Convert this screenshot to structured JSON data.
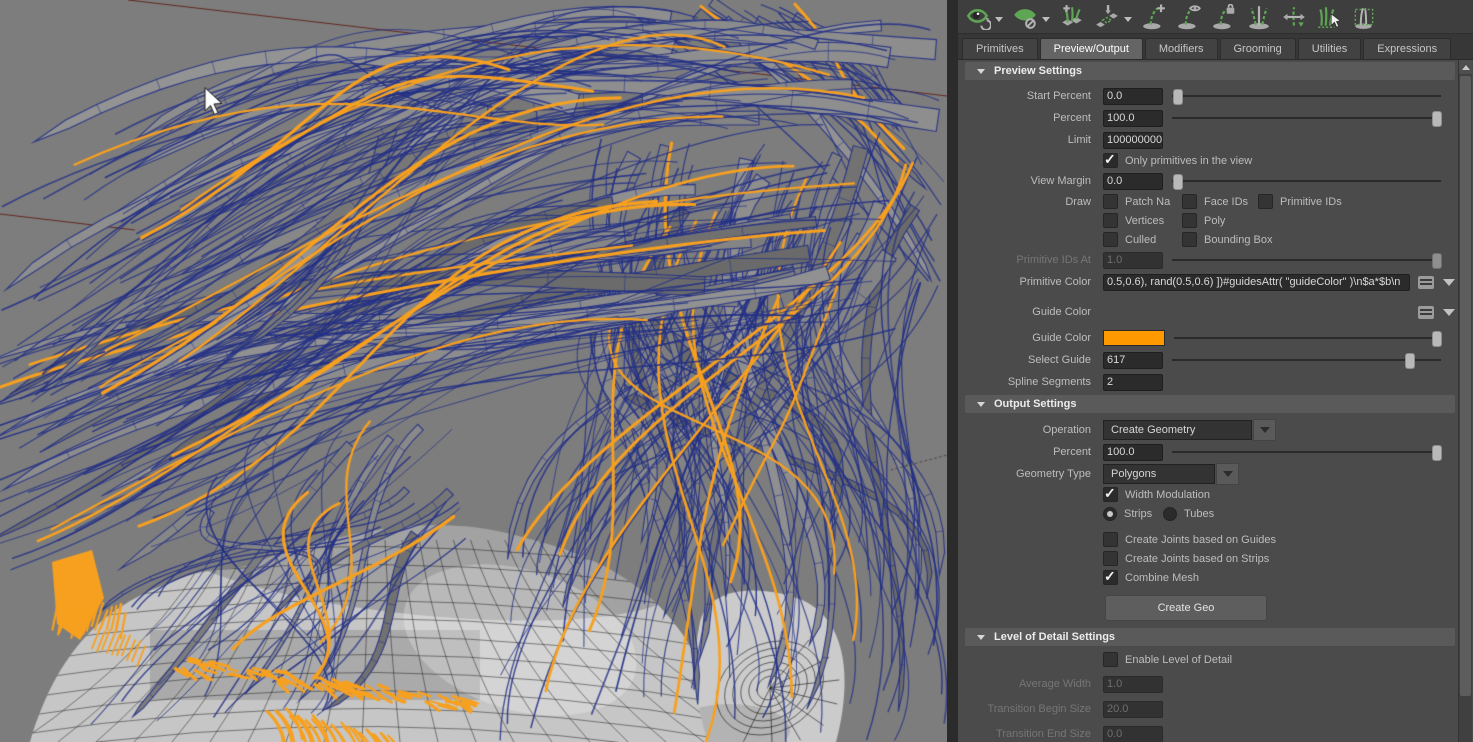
{
  "viewport": {
    "background": "#7d7d7d",
    "hair_fill_color": "#848484",
    "hair_wire_color": "#222f85",
    "guide_color": "#f7a01f",
    "head_color": "#c6c6c6",
    "head_wire_color": "#1b1b1b",
    "grid_line_color": "#63261f",
    "cursor": "arrow"
  },
  "toolbar": {
    "accent_color": "#5ea653",
    "icons": [
      {
        "name": "eye-rotate-icon",
        "dropdown": true
      },
      {
        "name": "eye-disabled-icon",
        "dropdown": true
      },
      {
        "name": "grass-add-icon",
        "dropdown": false
      },
      {
        "name": "strips-insert-icon",
        "dropdown": true
      },
      {
        "name": "strand-add-icon",
        "dropdown": false
      },
      {
        "name": "strand-visibility-icon",
        "dropdown": false
      },
      {
        "name": "strand-lock-icon",
        "dropdown": false
      },
      {
        "name": "strand-split-icon",
        "dropdown": false
      },
      {
        "name": "strand-swap-icon",
        "dropdown": false
      },
      {
        "name": "grass-select-icon",
        "dropdown": false
      },
      {
        "name": "strand-marquee-icon",
        "dropdown": false
      }
    ]
  },
  "tabs": [
    {
      "label": "Primitives",
      "selected": false
    },
    {
      "label": "Preview/Output",
      "selected": true
    },
    {
      "label": "Modifiers",
      "selected": false
    },
    {
      "label": "Grooming",
      "selected": false
    },
    {
      "label": "Utilities",
      "selected": false
    },
    {
      "label": "Expressions",
      "selected": false
    }
  ],
  "preview": {
    "title": "Preview Settings",
    "start_percent": {
      "label": "Start Percent",
      "value": "0.0",
      "slider": 0.02
    },
    "percent": {
      "label": "Percent",
      "value": "100.0",
      "slider": 0.98
    },
    "limit": {
      "label": "Limit",
      "value": "100000000"
    },
    "only_primitives": {
      "label": "Only primitives in the view",
      "checked": true
    },
    "view_margin": {
      "label": "View Margin",
      "value": "0.0",
      "slider": 0.02
    },
    "draw": {
      "label": "Draw",
      "options": [
        {
          "label": "Patch Na",
          "checked": false
        },
        {
          "label": "Face IDs",
          "checked": false
        },
        {
          "label": "Primitive IDs",
          "checked": false
        },
        {
          "label": "Vertices",
          "checked": false
        },
        {
          "label": "Poly",
          "checked": false
        },
        {
          "label": "Culled",
          "checked": false
        },
        {
          "label": "Bounding Box",
          "checked": false
        }
      ]
    },
    "primitive_ids_at": {
      "label": "Primitive IDs At",
      "value": "1.0",
      "slider": 0.98,
      "disabled": true
    },
    "primitive_color": {
      "label": "Primitive Color",
      "value": "0.5,0.6), rand(0.5,0.6) ])#guidesAttr( \"guideColor\" )\\n$a*$b\\n"
    },
    "guide_color_expr": {
      "label": "Guide Color"
    },
    "guide_color": {
      "label": "Guide Color",
      "swatch": "#ff9900",
      "slider": 0.98
    },
    "select_guide": {
      "label": "Select Guide",
      "value": "617",
      "slider": 0.88
    },
    "spline_segments": {
      "label": "Spline Segments",
      "value": "2"
    }
  },
  "output": {
    "title": "Output Settings",
    "operation": {
      "label": "Operation",
      "value": "Create Geometry"
    },
    "percent": {
      "label": "Percent",
      "value": "100.0",
      "slider": 0.98
    },
    "geometry_type": {
      "label": "Geometry Type",
      "value": "Polygons"
    },
    "width_modulation": {
      "label": "Width Modulation",
      "checked": true
    },
    "strip_mode": {
      "options": [
        {
          "label": "Strips",
          "selected": true
        },
        {
          "label": "Tubes",
          "selected": false
        }
      ]
    },
    "create_joints_guides": {
      "label": "Create Joints based on Guides",
      "checked": false
    },
    "create_joints_strips": {
      "label": "Create Joints based on Strips",
      "checked": false
    },
    "combine_mesh": {
      "label": "Combine Mesh",
      "checked": true
    },
    "create_geo_button": "Create Geo"
  },
  "lod": {
    "title": "Level of Detail Settings",
    "enable": {
      "label": "Enable Level of Detail",
      "checked": false
    },
    "average_width": {
      "label": "Average Width",
      "value": "1.0",
      "disabled": true
    },
    "transition_begin": {
      "label": "Transition Begin Size",
      "value": "20.0",
      "disabled": true
    },
    "transition_end": {
      "label": "Transition End Size",
      "value": "0.0",
      "disabled": true
    }
  }
}
